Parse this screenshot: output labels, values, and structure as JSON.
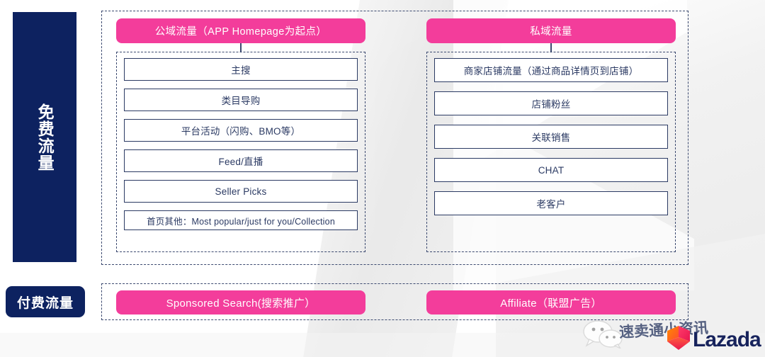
{
  "left_rail": {
    "free_traffic_label": "免费流量",
    "paid_traffic_label": "付费流量",
    "navy": "#0d2260"
  },
  "free_traffic": {
    "columns": [
      {
        "header": "公域流量（APP Homepage为起点）",
        "items": [
          {
            "label": "主搜"
          },
          {
            "label": "类目导购"
          },
          {
            "label": "平台活动（闪购、BMO等）"
          },
          {
            "label": "Feed/直播"
          },
          {
            "label": "Seller Picks"
          },
          {
            "label": "首页其他：Most popular/just for you/Collection"
          }
        ]
      },
      {
        "header": "私域流量",
        "items": [
          {
            "label": "商家店铺流量（通过商品详情页到店铺）"
          },
          {
            "label": "店铺粉丝"
          },
          {
            "label": "关联销售"
          },
          {
            "label": "CHAT"
          },
          {
            "label": "老客户"
          }
        ]
      }
    ]
  },
  "paid_traffic": {
    "items": [
      {
        "label": "Sponsored Search(搜索推广）"
      },
      {
        "label": "Affiliate（联盟广告）"
      }
    ]
  },
  "watermark": {
    "account_name": "速卖通小资讯",
    "brand": "Lazada"
  },
  "colors": {
    "pink": "#f33d9b",
    "navy": "#0d2260",
    "box_border": "#2b3a63",
    "dashed": "#3c4a70",
    "background": "#ffffff"
  }
}
